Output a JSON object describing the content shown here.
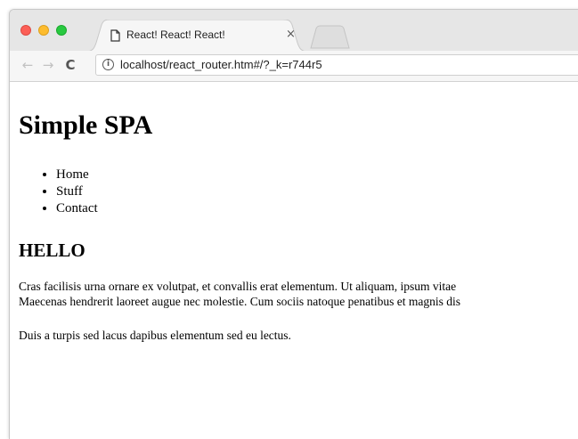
{
  "browser": {
    "tab": {
      "title": "React! React! React!",
      "close_glyph": "×",
      "favicon": "page-icon"
    },
    "new_tab": "new-tab-icon",
    "nav": {
      "back_glyph": "←",
      "forward_glyph": "→",
      "reload_glyph": "C"
    },
    "address_bar": {
      "info_glyph": "i",
      "url": "localhost/react_router.htm#/?_k=r744r5"
    },
    "traffic_lights": {
      "close_color": "#fc5f57",
      "minimize_color": "#fdbc2e",
      "maximize_color": "#28c940"
    }
  },
  "page": {
    "title": "Simple SPA",
    "nav_items": [
      {
        "label": "Home"
      },
      {
        "label": "Stuff"
      },
      {
        "label": "Contact"
      }
    ],
    "section": {
      "heading": "HELLO",
      "paragraph1_line1": "Cras facilisis urna ornare ex volutpat, et convallis erat elementum. Ut aliquam, ipsum vitae",
      "paragraph1_line2": "Maecenas hendrerit laoreet augue nec molestie. Cum sociis natoque penatibus et magnis dis",
      "paragraph2": "Duis a turpis sed lacus dapibus elementum sed eu lectus."
    }
  }
}
